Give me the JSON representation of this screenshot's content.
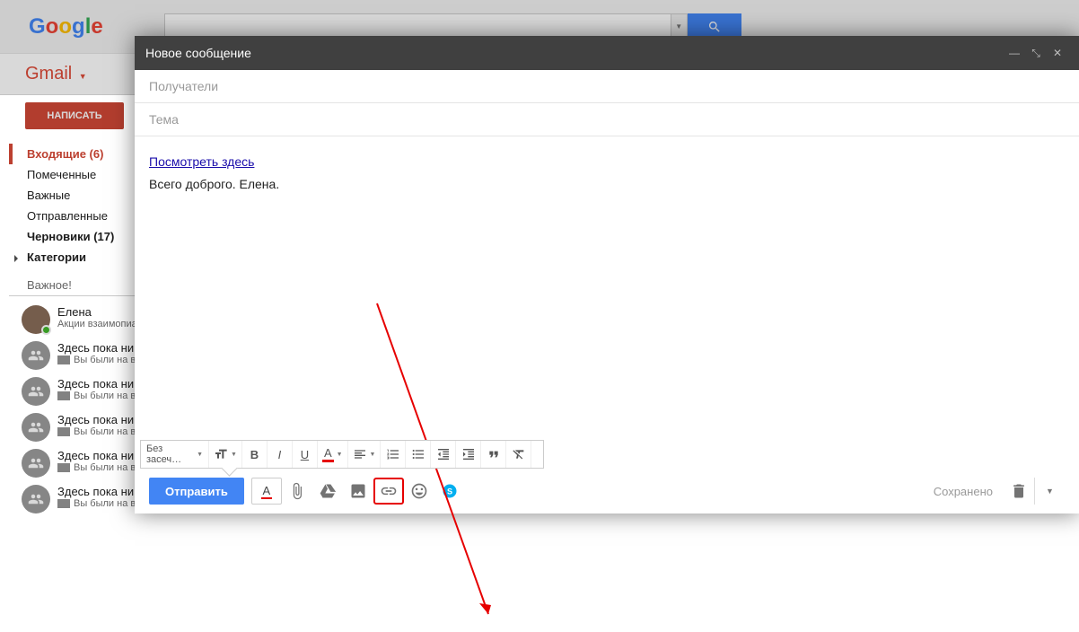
{
  "header": {
    "app": "Google",
    "product": "Gmail"
  },
  "sidebar": {
    "compose": "НАПИСАТЬ",
    "items": [
      {
        "label": "Входящие (6)",
        "active": true
      },
      {
        "label": "Помеченные"
      },
      {
        "label": "Важные"
      },
      {
        "label": "Отправленные"
      },
      {
        "label": "Черновики (17)",
        "bold": true
      },
      {
        "label": "Категории",
        "cat": true
      }
    ],
    "important_label": "Важное!"
  },
  "chat": {
    "me": {
      "name": "Елена",
      "sub": "Акции взаимопиа"
    },
    "rooms": [
      {
        "name": "Здесь пока ни",
        "sub": "Вы были на в"
      },
      {
        "name": "Здесь пока ни",
        "sub": "Вы были на в"
      },
      {
        "name": "Здесь пока ни",
        "sub": "Вы были на в"
      },
      {
        "name": "Здесь пока ни",
        "sub": "Вы были на в"
      },
      {
        "name": "Здесь пока ни",
        "sub": "Вы были на вид"
      }
    ]
  },
  "compose_window": {
    "title": "Новое сообщение",
    "recipients_placeholder": "Получатели",
    "subject_placeholder": "Тема",
    "body_link": "Посмотреть здесь",
    "body_text": "Всего доброго. Елена.",
    "font_label": "Без засеч…",
    "send": "Отправить",
    "saved": "Сохранено"
  }
}
